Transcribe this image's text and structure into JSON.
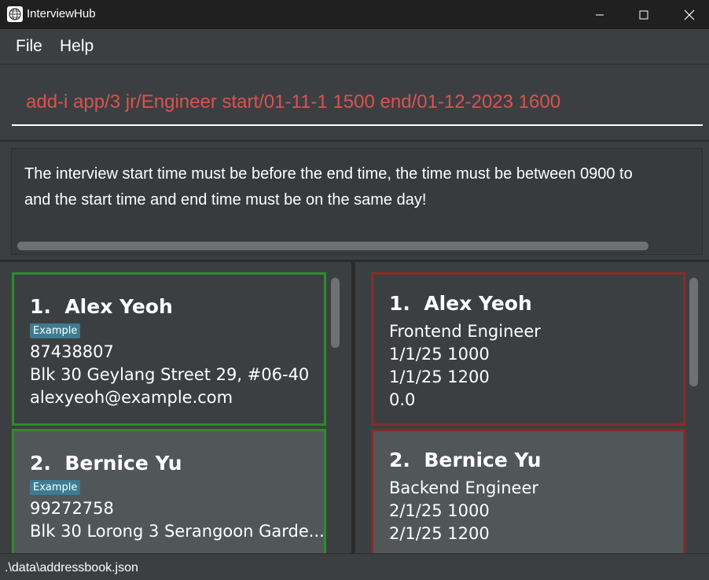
{
  "window": {
    "title": "InterviewHub",
    "icon": "globe-icon"
  },
  "menu": {
    "file": "File",
    "help": "Help"
  },
  "command": {
    "value": "add-i app/3 jr/Engineer start/01-11-1 1500 end/01-12-2023 1600"
  },
  "result": {
    "text": "The interview start time must be before the end time, the time must be between 0900 to\nand the start time and end time must be on the same day!"
  },
  "persons": [
    {
      "index": "1.",
      "name": "Alex Yeoh",
      "tag": "Example",
      "phone": "87438807",
      "address": "Blk 30 Geylang Street 29, #06-40",
      "email": "alexyeoh@example.com"
    },
    {
      "index": "2.",
      "name": "Bernice Yu",
      "tag": "Example",
      "phone": "99272758",
      "address": "Blk 30 Lorong 3 Serangoon Garde..."
    }
  ],
  "interviews": [
    {
      "index": "1.",
      "name": "Alex Yeoh",
      "role": "Frontend Engineer",
      "start": "1/1/25 1000",
      "end": "1/1/25 1200",
      "rating": "0.0"
    },
    {
      "index": "2.",
      "name": "Bernice Yu",
      "role": "Backend Engineer",
      "start": "2/1/25 1000",
      "end": "2/1/25 1200"
    }
  ],
  "status": {
    "path": ".\\data\\addressbook.json"
  },
  "colors": {
    "person_border": "#2e8b2e",
    "interview_border": "#8b2a2a",
    "command_error": "#d9534f",
    "tag": "#3e7b91"
  }
}
